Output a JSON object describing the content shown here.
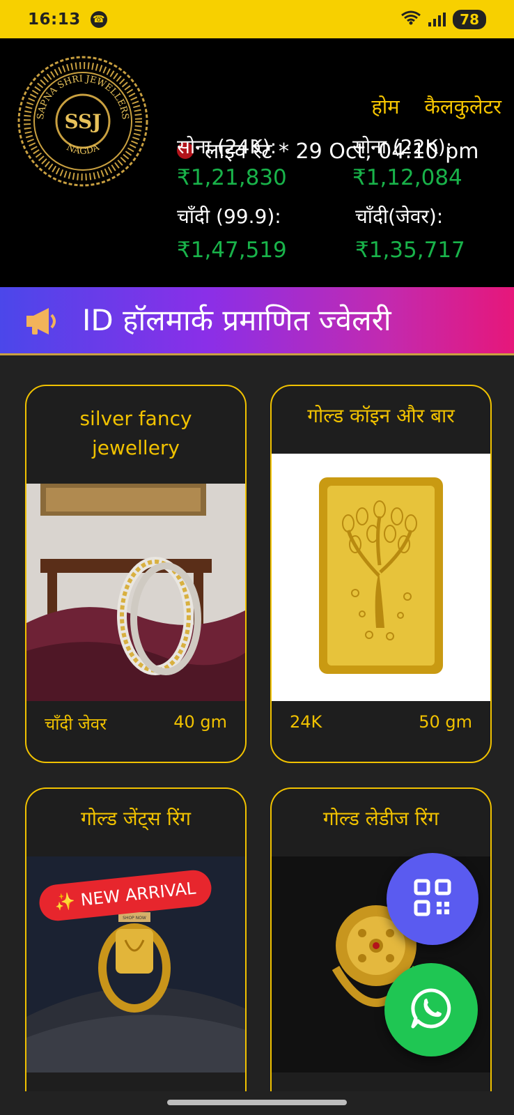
{
  "status_bar": {
    "time": "16:13",
    "battery": "78"
  },
  "header": {
    "logo": {
      "brand": "SAPNA SHRI JEWELLERS",
      "monogram": "SSJ",
      "city": "NAGDA"
    },
    "nav": {
      "home": "होम",
      "calculator": "कैलकुलेटर"
    },
    "live_rate": "लाइव रेट * 29 Oct, 04:10 pm",
    "rates": [
      {
        "label": "सोना (24K):",
        "value": "₹1,21,830"
      },
      {
        "label": "सोना (22K):",
        "value": "₹1,12,084"
      },
      {
        "label": "चाँदी (99.9):",
        "value": "₹1,47,519"
      },
      {
        "label": "चाँदी(जेवर):",
        "value": "₹1,35,717"
      }
    ],
    "live_dot_color": "#b3141b",
    "rate_value_color": "#19b34a"
  },
  "banner": {
    "text": "ID हॉलमार्क प्रमाणित ज्वेलरी",
    "icon": "megaphone-icon"
  },
  "products": [
    {
      "title": "silver fancy jewellery",
      "category": "चाँदी जेवर",
      "weight": "40 gm"
    },
    {
      "title": "गोल्ड कॉइन और बार",
      "category": "24K",
      "weight": "50 gm"
    },
    {
      "title": "गोल्ड जेंट्स रिंग",
      "badge": "✨ NEW ARRIVAL",
      "image_caption": "SHOP NOW"
    },
    {
      "title": "गोल्ड लेडीज रिंग"
    }
  ],
  "fabs": {
    "qr": "qr-code-icon",
    "whatsapp": "whatsapp-icon"
  },
  "colors": {
    "accent": "#f1c200",
    "status_bar": "#f7d000",
    "qr_fab": "#5a5bf0",
    "whatsapp_fab": "#1fc653"
  }
}
